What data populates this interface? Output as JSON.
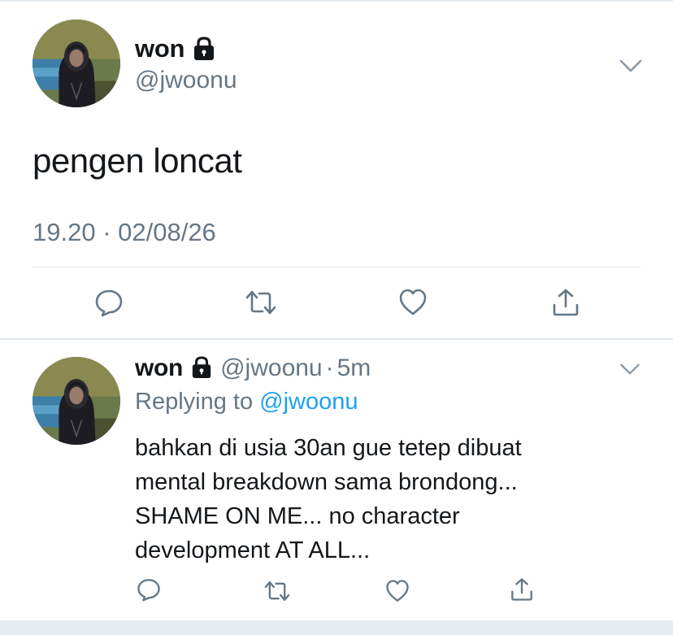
{
  "main_tweet": {
    "display_name": "won",
    "handle": "@jwoonu",
    "text": "pengen loncat",
    "timestamp": "19.20 · 02/08/26",
    "actions": [
      "reply-icon",
      "retweet-icon",
      "like-icon",
      "share-icon"
    ]
  },
  "reply_tweet": {
    "display_name": "won",
    "handle": "@jwoonu",
    "separator": "·",
    "time": "5m",
    "replying_prefix": "Replying to",
    "replying_mention": "@jwoonu",
    "text_lines": [
      "bahkan di usia 30an gue tetep dibuat",
      "mental breakdown sama brondong...",
      "SHAME ON ME... no character",
      "development AT ALL..."
    ],
    "actions": [
      "reply-icon",
      "retweet-icon",
      "like-icon",
      "share-icon"
    ]
  },
  "colors": {
    "text_primary": "#14171a",
    "text_secondary": "#657786",
    "link": "#1da1f2",
    "divider": "#e1e8ed",
    "icon": "#657786"
  }
}
